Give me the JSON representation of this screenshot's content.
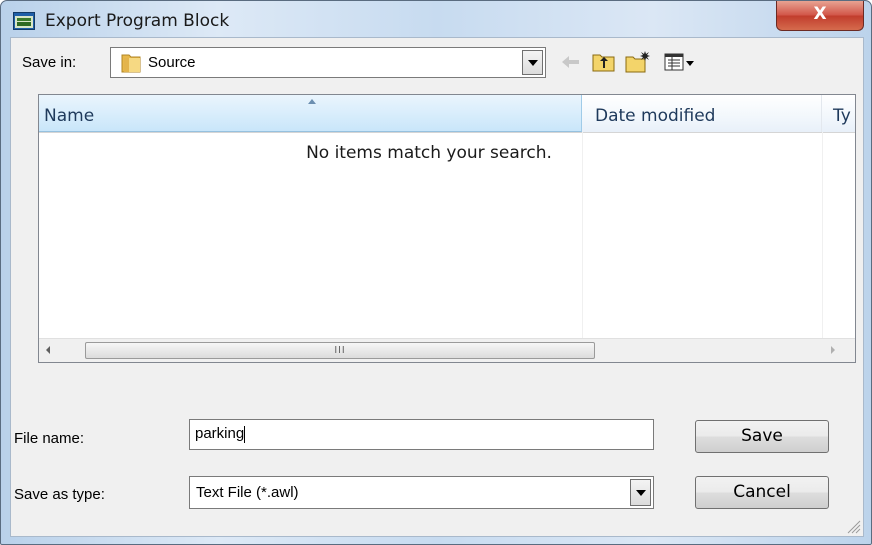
{
  "window": {
    "title": "Export Program Block",
    "close_label": "X"
  },
  "save_in": {
    "label": "Save in:",
    "value": "Source"
  },
  "toolbar": {
    "icons": [
      "back-arrow-icon",
      "up-folder-icon",
      "new-folder-icon",
      "view-menu-icon"
    ]
  },
  "file_list": {
    "columns": [
      "Name",
      "Date modified",
      "Ty"
    ],
    "empty_message": "No items match your search.",
    "scroll_thumb_grip": "III"
  },
  "file_name": {
    "label": "File name:",
    "value": "parking"
  },
  "save_as_type": {
    "label": "Save as type:",
    "value": "Text File (*.awl)"
  },
  "buttons": {
    "save": "Save",
    "cancel": "Cancel"
  }
}
